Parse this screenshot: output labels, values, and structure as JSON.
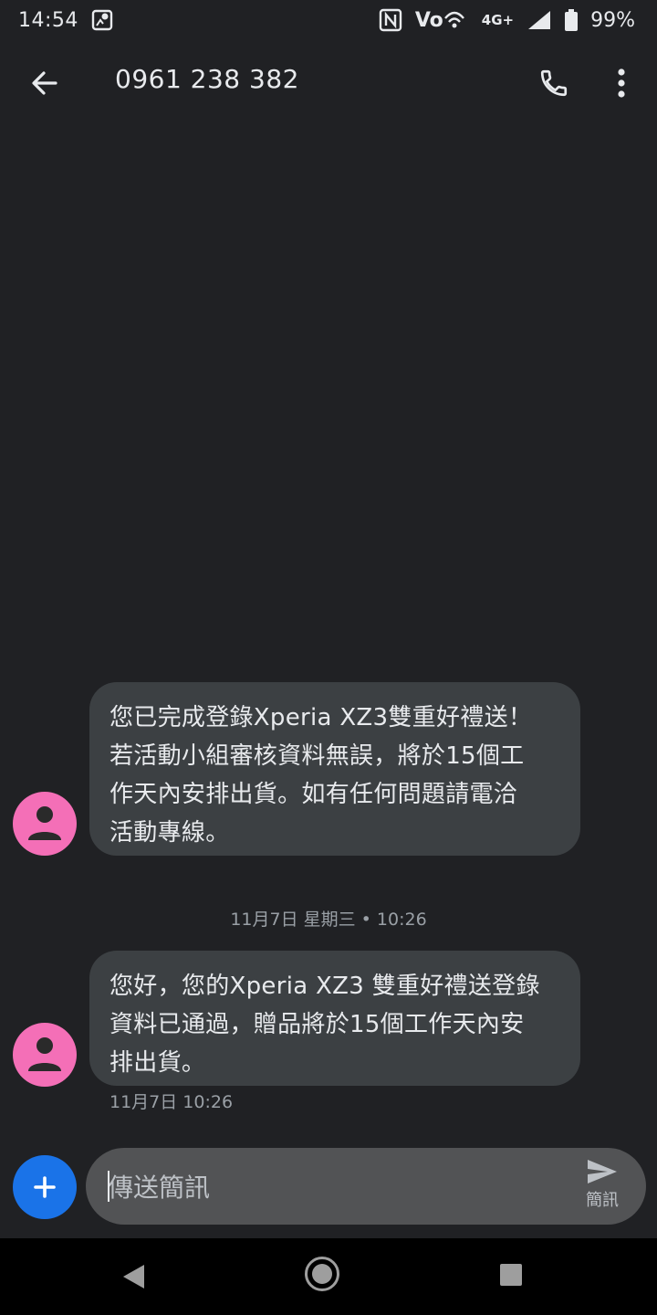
{
  "status_bar": {
    "time": "14:54",
    "network_type": "4G+",
    "volte_label": "Vo",
    "battery_percent": "99%",
    "icons": [
      "location-icon",
      "nfc-icon",
      "volte-icon",
      "signal-icon",
      "battery-icon"
    ]
  },
  "app_bar": {
    "title": "0961 238 382",
    "icons": [
      "back-arrow-icon",
      "phone-icon",
      "more-vert-icon"
    ]
  },
  "messages": [
    {
      "lines": [
        "您已完成登錄Xperia XZ3雙重好禮送！",
        "若活動小組審核資料無誤，將於15個工",
        "作天內安排出貨。如有任何問題請電洽",
        "活動專線。"
      ]
    },
    {
      "lines": [
        "您好，您的Xperia XZ3 雙重好禮送登錄",
        "資料已通過，贈品將於15個工作天內安",
        "排出貨。"
      ],
      "timestamp": "11月7日 10:26"
    }
  ],
  "date_divider": "11月7日 星期三 • 10:26",
  "compose": {
    "placeholder": "傳送簡訊",
    "send_label": "簡訊"
  },
  "colors": {
    "background": "#202124",
    "bubble": "#3c4043",
    "avatar": "#f46fb7",
    "add_button": "#1a73e8",
    "compose_field": "#525355"
  },
  "nav_bar": {
    "icons": [
      "nav-back-icon",
      "nav-home-icon",
      "nav-recents-icon"
    ]
  }
}
